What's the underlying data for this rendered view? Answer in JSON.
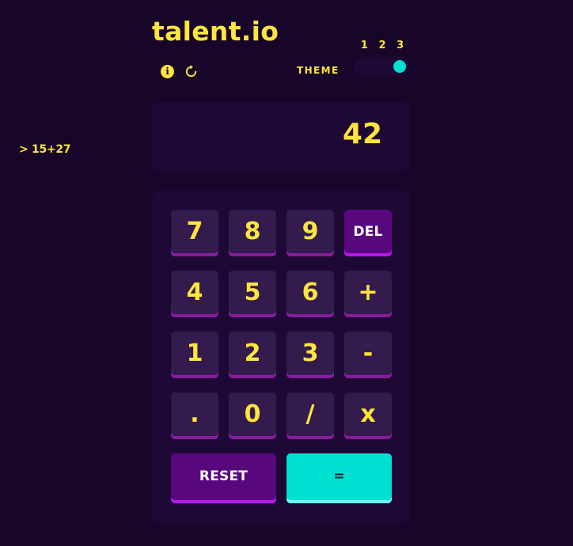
{
  "history": {
    "expression": "> 15+27"
  },
  "header": {
    "logo": "talent.io",
    "info_icon": "info-icon",
    "reset_icon": "refresh-icon",
    "theme_label": "THEME",
    "theme_options": [
      "1",
      "2",
      "3"
    ],
    "selected_theme": "3"
  },
  "screen": {
    "value": "42"
  },
  "keypad": {
    "keys": [
      "7",
      "8",
      "9",
      "DEL",
      "4",
      "5",
      "6",
      "+",
      "1",
      "2",
      "3",
      "-",
      ".",
      "0",
      "/",
      "x"
    ],
    "reset_label": "RESET",
    "equals_label": "="
  },
  "colors": {
    "background": "#17062a",
    "panel": "#1e0836",
    "key": "#331b4d",
    "key_shadow": "#881c9e",
    "accent_text": "#ffe53d",
    "purple_key": "#58077d",
    "cyan_key": "#00e0d1"
  }
}
